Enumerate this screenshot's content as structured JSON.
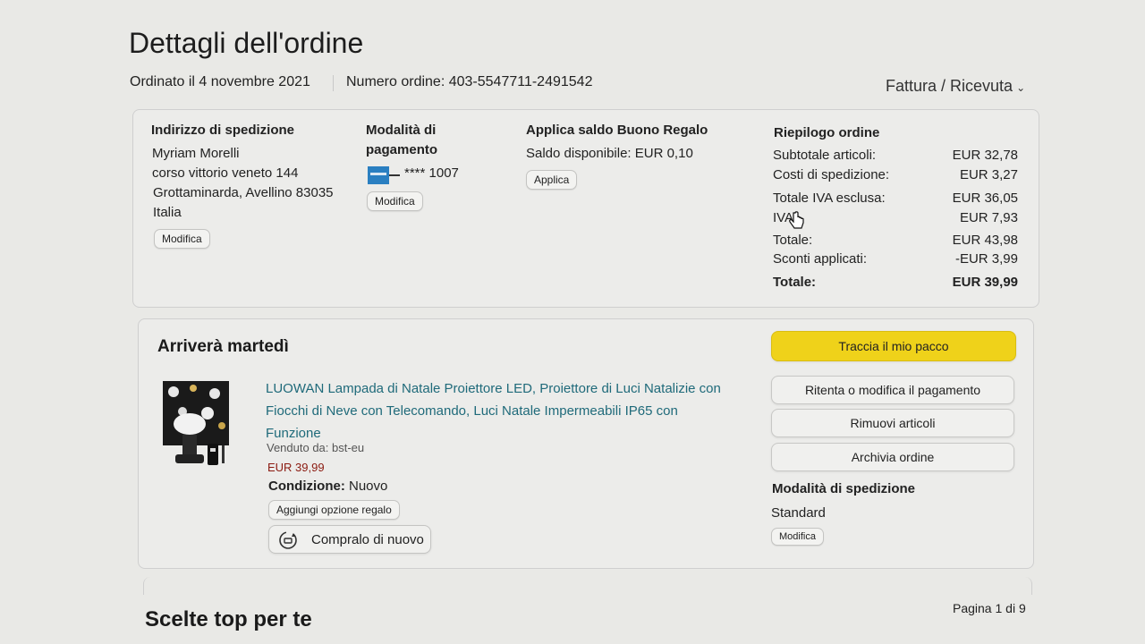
{
  "header": {
    "title": "Dettagli dell'ordine",
    "ordered": "Ordinato il 4 novembre 2021",
    "order_number": "Numero ordine: 403-5547711-2491542",
    "invoice": "Fattura / Ricevuta"
  },
  "shipping_address": {
    "label": "Indirizzo di spedizione",
    "name": "Myriam Morelli",
    "street": "corso vittorio veneto 144",
    "city": "Grottaminarda, Avellino 83035",
    "country": "Italia",
    "edit": "Modifica"
  },
  "payment": {
    "label_line1": "Modalità di",
    "label_line2": "pagamento",
    "card": "**** 1007",
    "edit": "Modifica"
  },
  "gift": {
    "label": "Applica saldo Buono Regalo",
    "balance": "Saldo disponibile: EUR 0,10",
    "apply": "Applica"
  },
  "summary": {
    "label": "Riepilogo ordine",
    "rows": [
      {
        "k": "Subtotale articoli:",
        "v": "EUR 32,78"
      },
      {
        "k": "Costi di spedizione:",
        "v": "EUR 3,27"
      },
      {
        "k": "Totale IVA esclusa:",
        "v": "EUR 36,05"
      },
      {
        "k": "IVA:",
        "v": "EUR 7,93"
      },
      {
        "k": "Totale:",
        "v": "EUR 43,98"
      },
      {
        "k": "Sconti applicati:",
        "v": "-EUR 3,99"
      },
      {
        "k": "Totale:",
        "v": "EUR 39,99"
      }
    ]
  },
  "shipment": {
    "arrival": "Arriverà martedì",
    "product_line1": "LUOWAN Lampada di Natale Proiettore LED, Proiettore di Luci Natalizie con",
    "product_line2": "Fiocchi di Neve con Telecomando, Luci Natale Impermeabili IP65 con",
    "product_line3": "Funzione",
    "seller": "Venduto da: bst-eu",
    "price": "EUR 39,99",
    "condition_label": "Condizione:",
    "condition_value": "Nuovo",
    "gift_option": "Aggiungi opzione regalo",
    "buy_again": "Compralo di nuovo",
    "track": "Traccia il mio pacco",
    "retry_payment": "Ritenta o modifica il pagamento",
    "remove_items": "Rimuovi articoli",
    "archive": "Archivia ordine",
    "ship_method_label": "Modalità di spedizione",
    "ship_method": "Standard",
    "ship_edit": "Modifica"
  },
  "footer": {
    "top_picks": "Scelte top per te",
    "pager": "Pagina 1 di 9"
  },
  "colors": {
    "track_button": "#efd21a",
    "product_link": "#1f6a7a",
    "price": "#8b1a10"
  }
}
